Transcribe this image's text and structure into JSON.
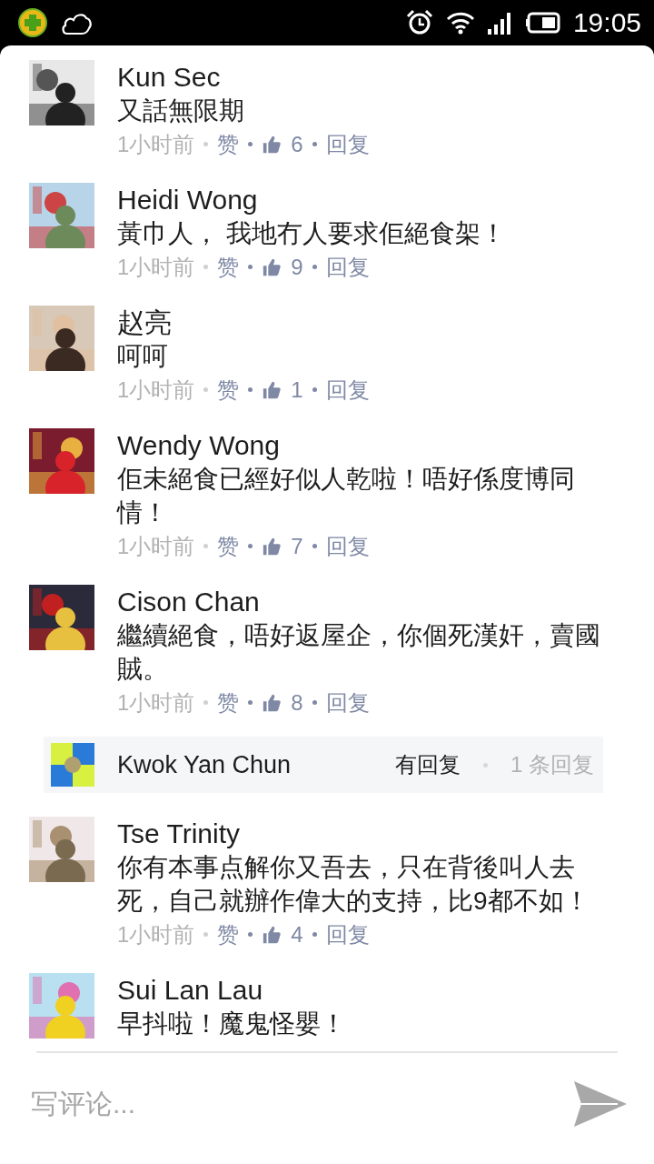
{
  "status_bar": {
    "time": "19:05"
  },
  "comments": [
    {
      "name": "Kun Sec",
      "text": "又話無限期",
      "meta": {
        "time": "1小时前",
        "like_label": "赞",
        "likes": "6",
        "reply_label": "回复"
      }
    },
    {
      "name": "Heidi Wong",
      "text": "黃巾人， 我地冇人要求佢絕食架！",
      "meta": {
        "time": "1小时前",
        "like_label": "赞",
        "likes": "9",
        "reply_label": "回复"
      }
    },
    {
      "name": "赵亮",
      "text": "呵呵",
      "meta": {
        "time": "1小时前",
        "like_label": "赞",
        "likes": "1",
        "reply_label": "回复"
      }
    },
    {
      "name": "Wendy Wong",
      "text": "佢未絕食已經好似人乾啦！唔好係度博同情！",
      "meta": {
        "time": "1小时前",
        "like_label": "赞",
        "likes": "7",
        "reply_label": "回复"
      }
    },
    {
      "name": "Cison Chan",
      "text": "繼續絕食，唔好返屋企，你個死漢奸，賣國賊。",
      "meta": {
        "time": "1小时前",
        "like_label": "赞",
        "likes": "8",
        "reply_label": "回复"
      },
      "reply_preview": {
        "name": "Kwok Yan Chun",
        "label": "有回复",
        "count": "1 条回复"
      }
    },
    {
      "name": "Tse Trinity",
      "text": "你有本事点解你又吾去，只在背後叫人去死，自己就辦作偉大的支持，比9都不如！",
      "meta": {
        "time": "1小时前",
        "like_label": "赞",
        "likes": "4",
        "reply_label": "回复"
      }
    },
    {
      "name": "Sui Lan Lau",
      "text": "早抖啦！魔鬼怪嬰！"
    }
  ],
  "composer": {
    "placeholder": "写评论..."
  }
}
